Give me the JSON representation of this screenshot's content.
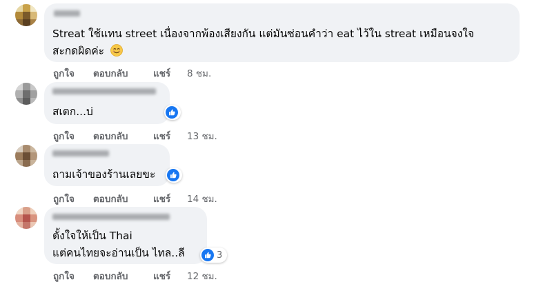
{
  "comments": [
    {
      "text_lines": [
        "Streat ใช้แทน street เนื่องจากพ้องเสียงกัน แต่มันซ่อนคำว่า eat ไว้ใน streat เหมือนจงใจ",
        "สะกดผิดค่ะ"
      ],
      "emoji_icon": "smiling-face-emoji",
      "actions": {
        "like": "ถูกใจ",
        "reply": "ตอบกลับ",
        "share": "แชร์",
        "time": "8 ชม."
      }
    },
    {
      "text_lines": [
        "สเตก...บ่"
      ],
      "reaction": {
        "icon": "like-reaction-icon",
        "count": ""
      },
      "actions": {
        "like": "ถูกใจ",
        "reply": "ตอบกลับ",
        "share": "แชร์",
        "time": "13 ชม."
      }
    },
    {
      "text_lines": [
        "ถามเจ้าของร้านเลยขะ"
      ],
      "reaction": {
        "icon": "like-reaction-icon",
        "count": ""
      },
      "actions": {
        "like": "ถูกใจ",
        "reply": "ตอบกลับ",
        "share": "แชร์",
        "time": "14 ชม."
      }
    },
    {
      "text_lines": [
        "ตั้งใจให้เป็น Thai",
        "แต่คนไทยจะอ่านเป็น ไทล..ลี"
      ],
      "reaction": {
        "icon": "like-reaction-icon",
        "count": "3"
      },
      "actions": {
        "like": "ถูกใจ",
        "reply": "ตอบกลับ",
        "share": "แชร์",
        "time": "12 ชม."
      }
    }
  ],
  "colors": {
    "bubble": "#f0f2f5",
    "action_text": "#65676b",
    "comment_text": "#050505",
    "like_blue": "#1877f2"
  }
}
